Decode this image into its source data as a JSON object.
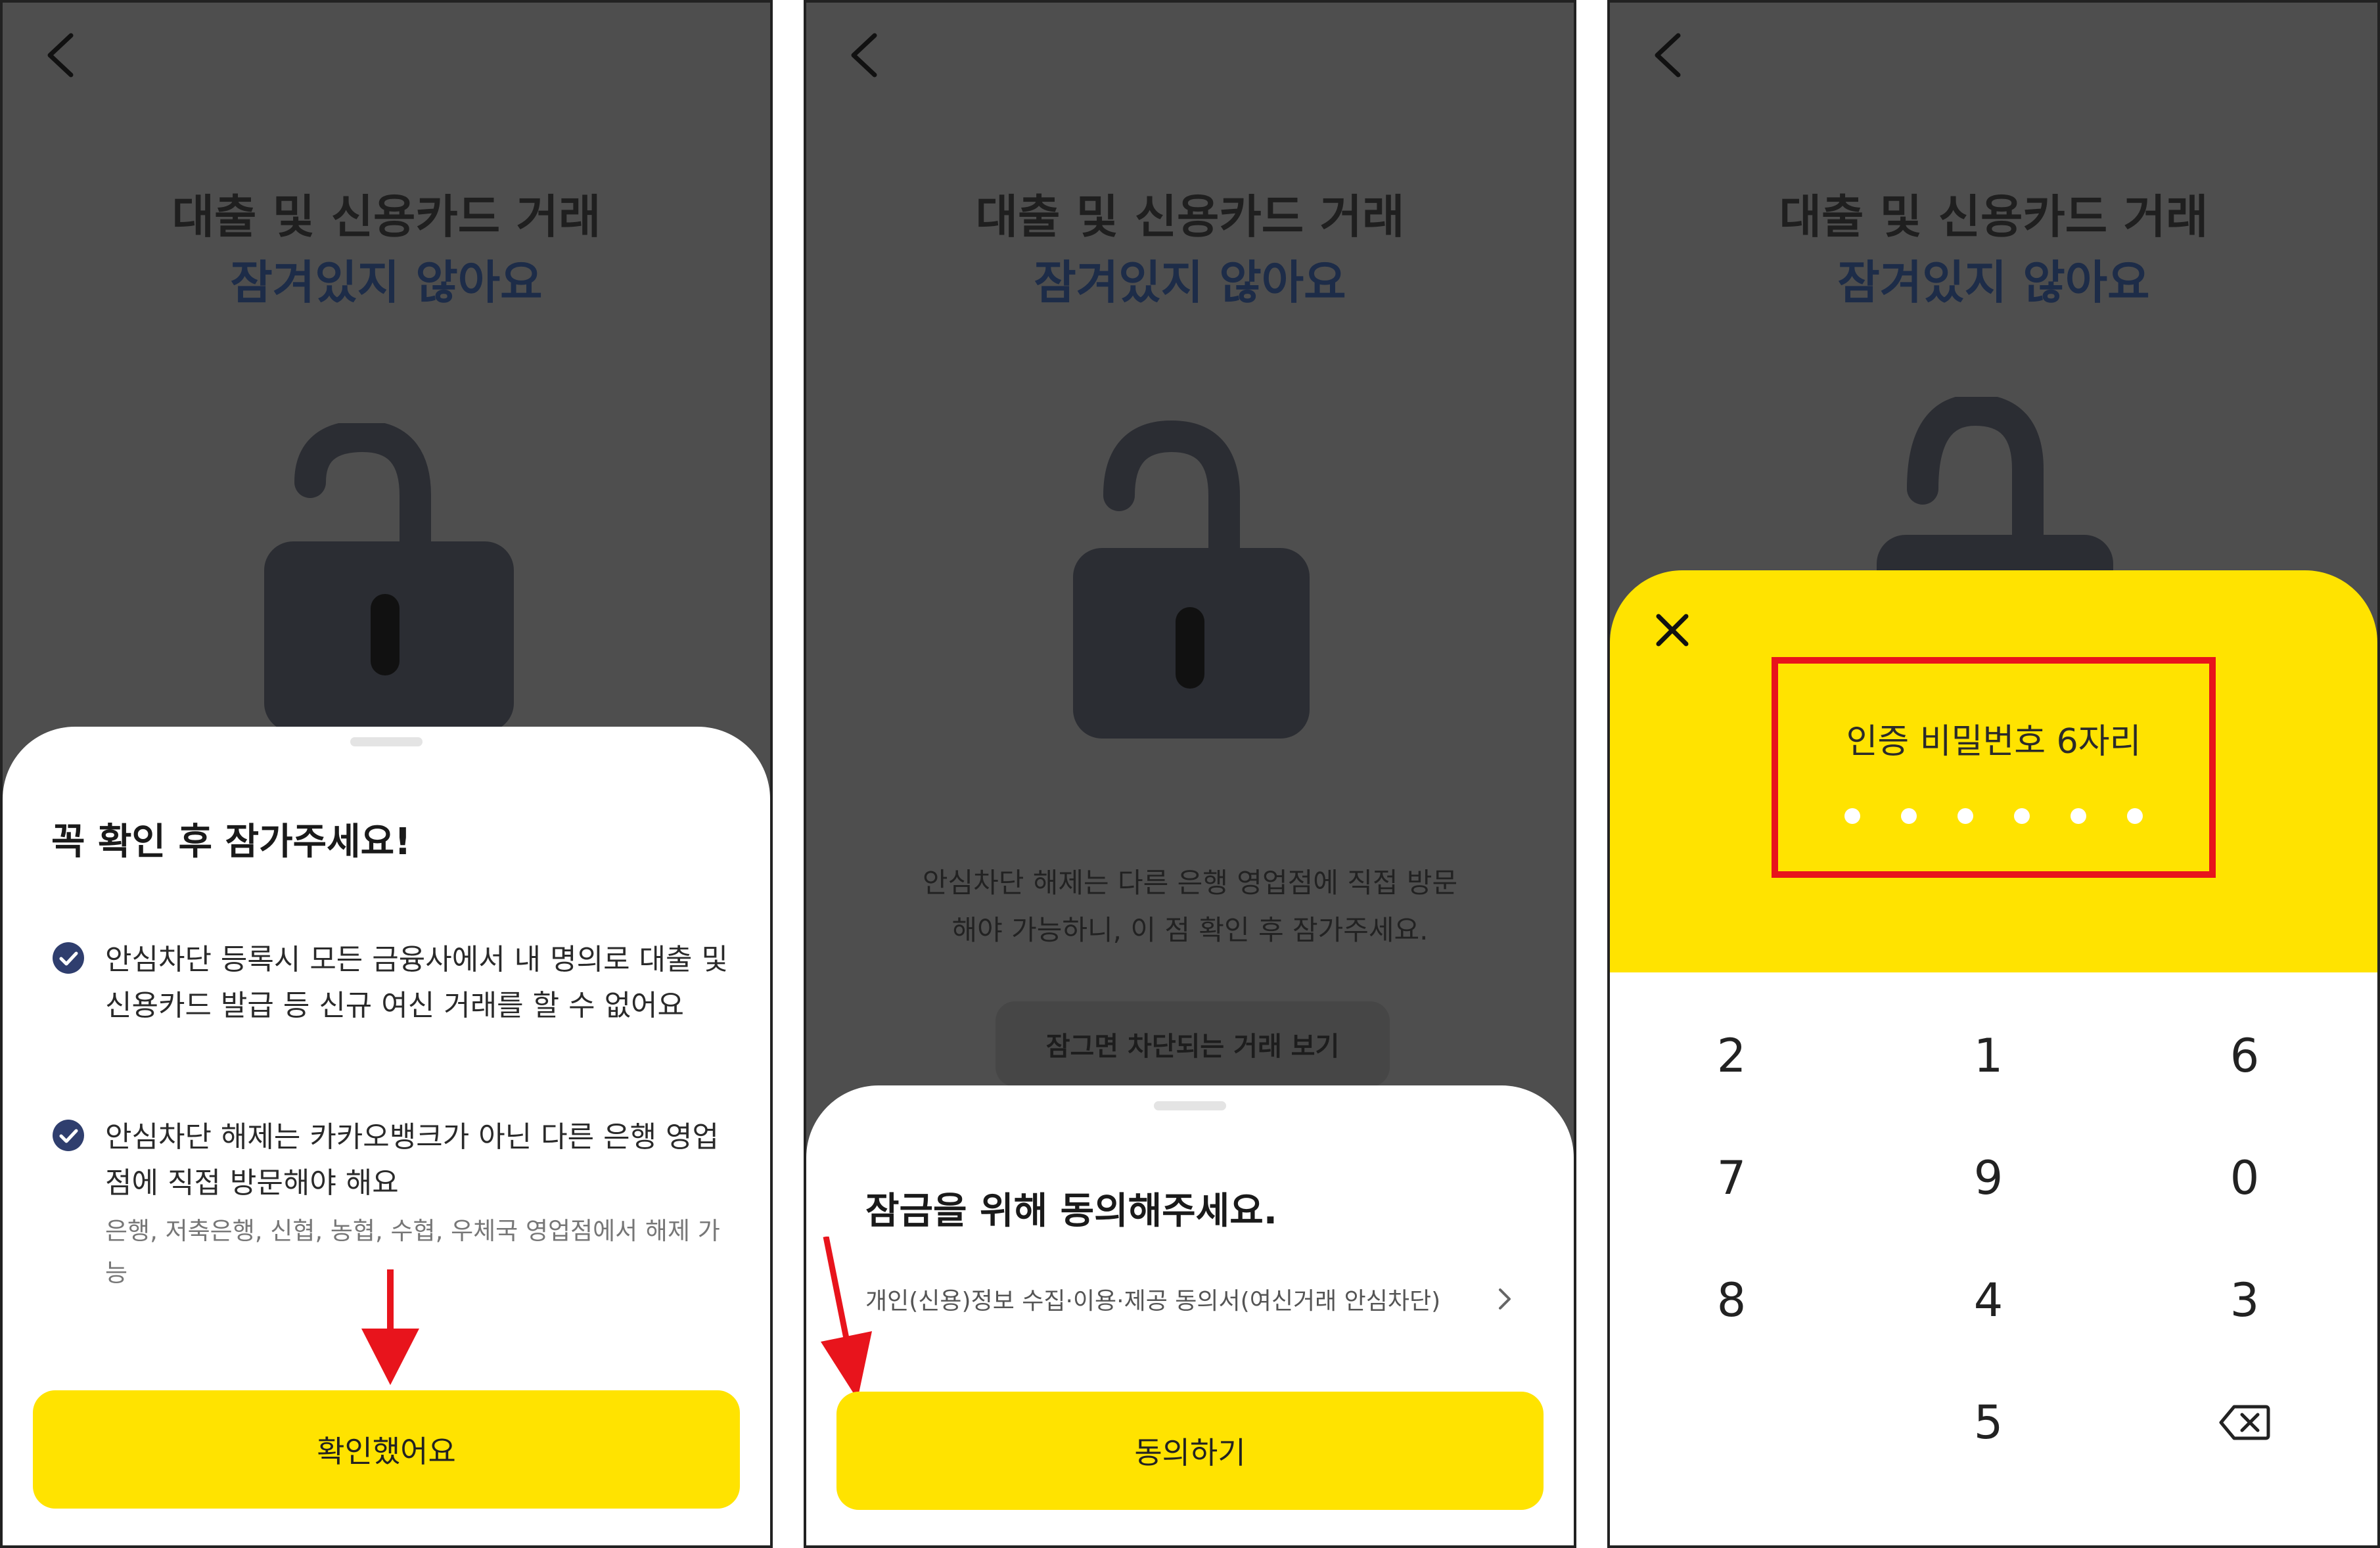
{
  "screens": [
    {
      "title_line1": "대출 및 신용카드 거래",
      "title_line2": "잠겨있지 않아요",
      "sheet": {
        "title": "꼭 확인 후 잠가주세요!",
        "items": [
          {
            "text": "안심차단 등록시 모든 금융사에서 내 명의로 대출 및 신용카드 발급 등 신규 여신 거래를 할 수 없어요",
            "sub": ""
          },
          {
            "text": "안심차단 해제는 카카오뱅크가 아닌 다른 은행 영업점에 직접 방문해야 해요",
            "sub": "은행, 저축은행, 신협, 농협, 수협, 우체국 영업점에서 해제 가능"
          }
        ],
        "button_label": "확인했어요"
      }
    },
    {
      "title_line1": "대출 및 신용카드 거래",
      "title_line2": "잠겨있지 않아요",
      "info_text": "안심차단 해제는 다른 은행 영업점에 직접 방문해야 가능하니, 이 점 확인 후 잠가주세요.",
      "view_blocked_label": "잠그면 차단되는 거래 보기",
      "sheet": {
        "title": "잠금을 위해 동의해주세요.",
        "consent_item": "개인(신용)정보 수집·이용·제공 동의서(여신거래 안심차단)",
        "button_label": "동의하기"
      }
    },
    {
      "title_line1": "대출 및 신용카드 거래",
      "title_line2": "잠겨있지 않아요",
      "pin_label": "인증 비밀번호 6자리",
      "pin_length": 6,
      "keys": [
        "2",
        "1",
        "6",
        "7",
        "9",
        "0",
        "8",
        "4",
        "3",
        "",
        "5",
        "backspace"
      ]
    }
  ],
  "colors": {
    "accent_yellow": "#ffe300",
    "overlay_bg": "#4e4e4e",
    "title_blue": "#1d2c48",
    "check_blue": "#2f3e6e",
    "highlight_red": "#e8141c"
  },
  "icons": {
    "back": "chevron-left-icon",
    "check": "check-circle-icon",
    "close": "close-icon",
    "chevron": "chevron-right-icon",
    "backspace": "backspace-icon",
    "lock": "unlocked-padlock-icon",
    "annotation": "red-arrow-icon"
  }
}
